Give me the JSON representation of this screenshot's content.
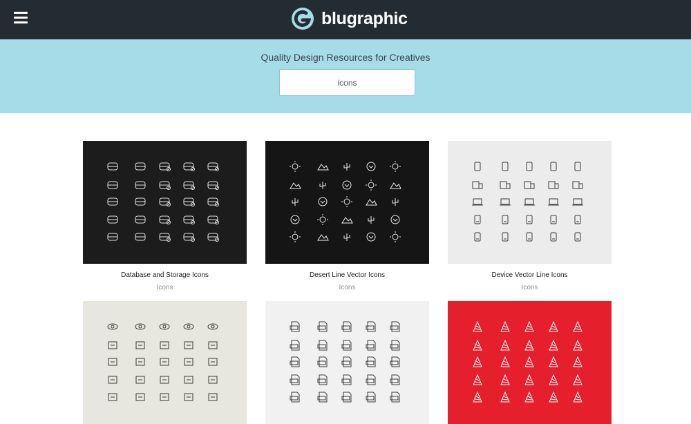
{
  "header": {
    "menu_icon": "hamburger-icon",
    "logo_icon": "blugraphic-logo-icon",
    "brand": "blugraphic"
  },
  "hero": {
    "tagline": "Quality Design Resources for Creatives",
    "search_value": "icons"
  },
  "cards": [
    {
      "title": "Database and Storage Icons",
      "category": "Icons",
      "bg": "#1c1c1c",
      "ink": "#e6e6e6"
    },
    {
      "title": "Desert Line Vector Icons",
      "category": "Icons",
      "bg": "#151515",
      "ink": "#eeeeee"
    },
    {
      "title": "Device Vector Line Icons",
      "category": "Icons",
      "bg": "#ececec",
      "ink": "#3a3a3a"
    },
    {
      "title": "",
      "category": "",
      "bg": "#e7e7df",
      "ink": "#3a3a3a"
    },
    {
      "title": "",
      "category": "",
      "bg": "#f1f1f1",
      "ink": "#3a3a3a"
    },
    {
      "title": "",
      "category": "",
      "bg": "#e61f2c",
      "ink": "#ffffff"
    }
  ],
  "colors": {
    "topbar": "#232b33",
    "hero": "#a6dbe8",
    "logo": "#a6dbe8"
  }
}
